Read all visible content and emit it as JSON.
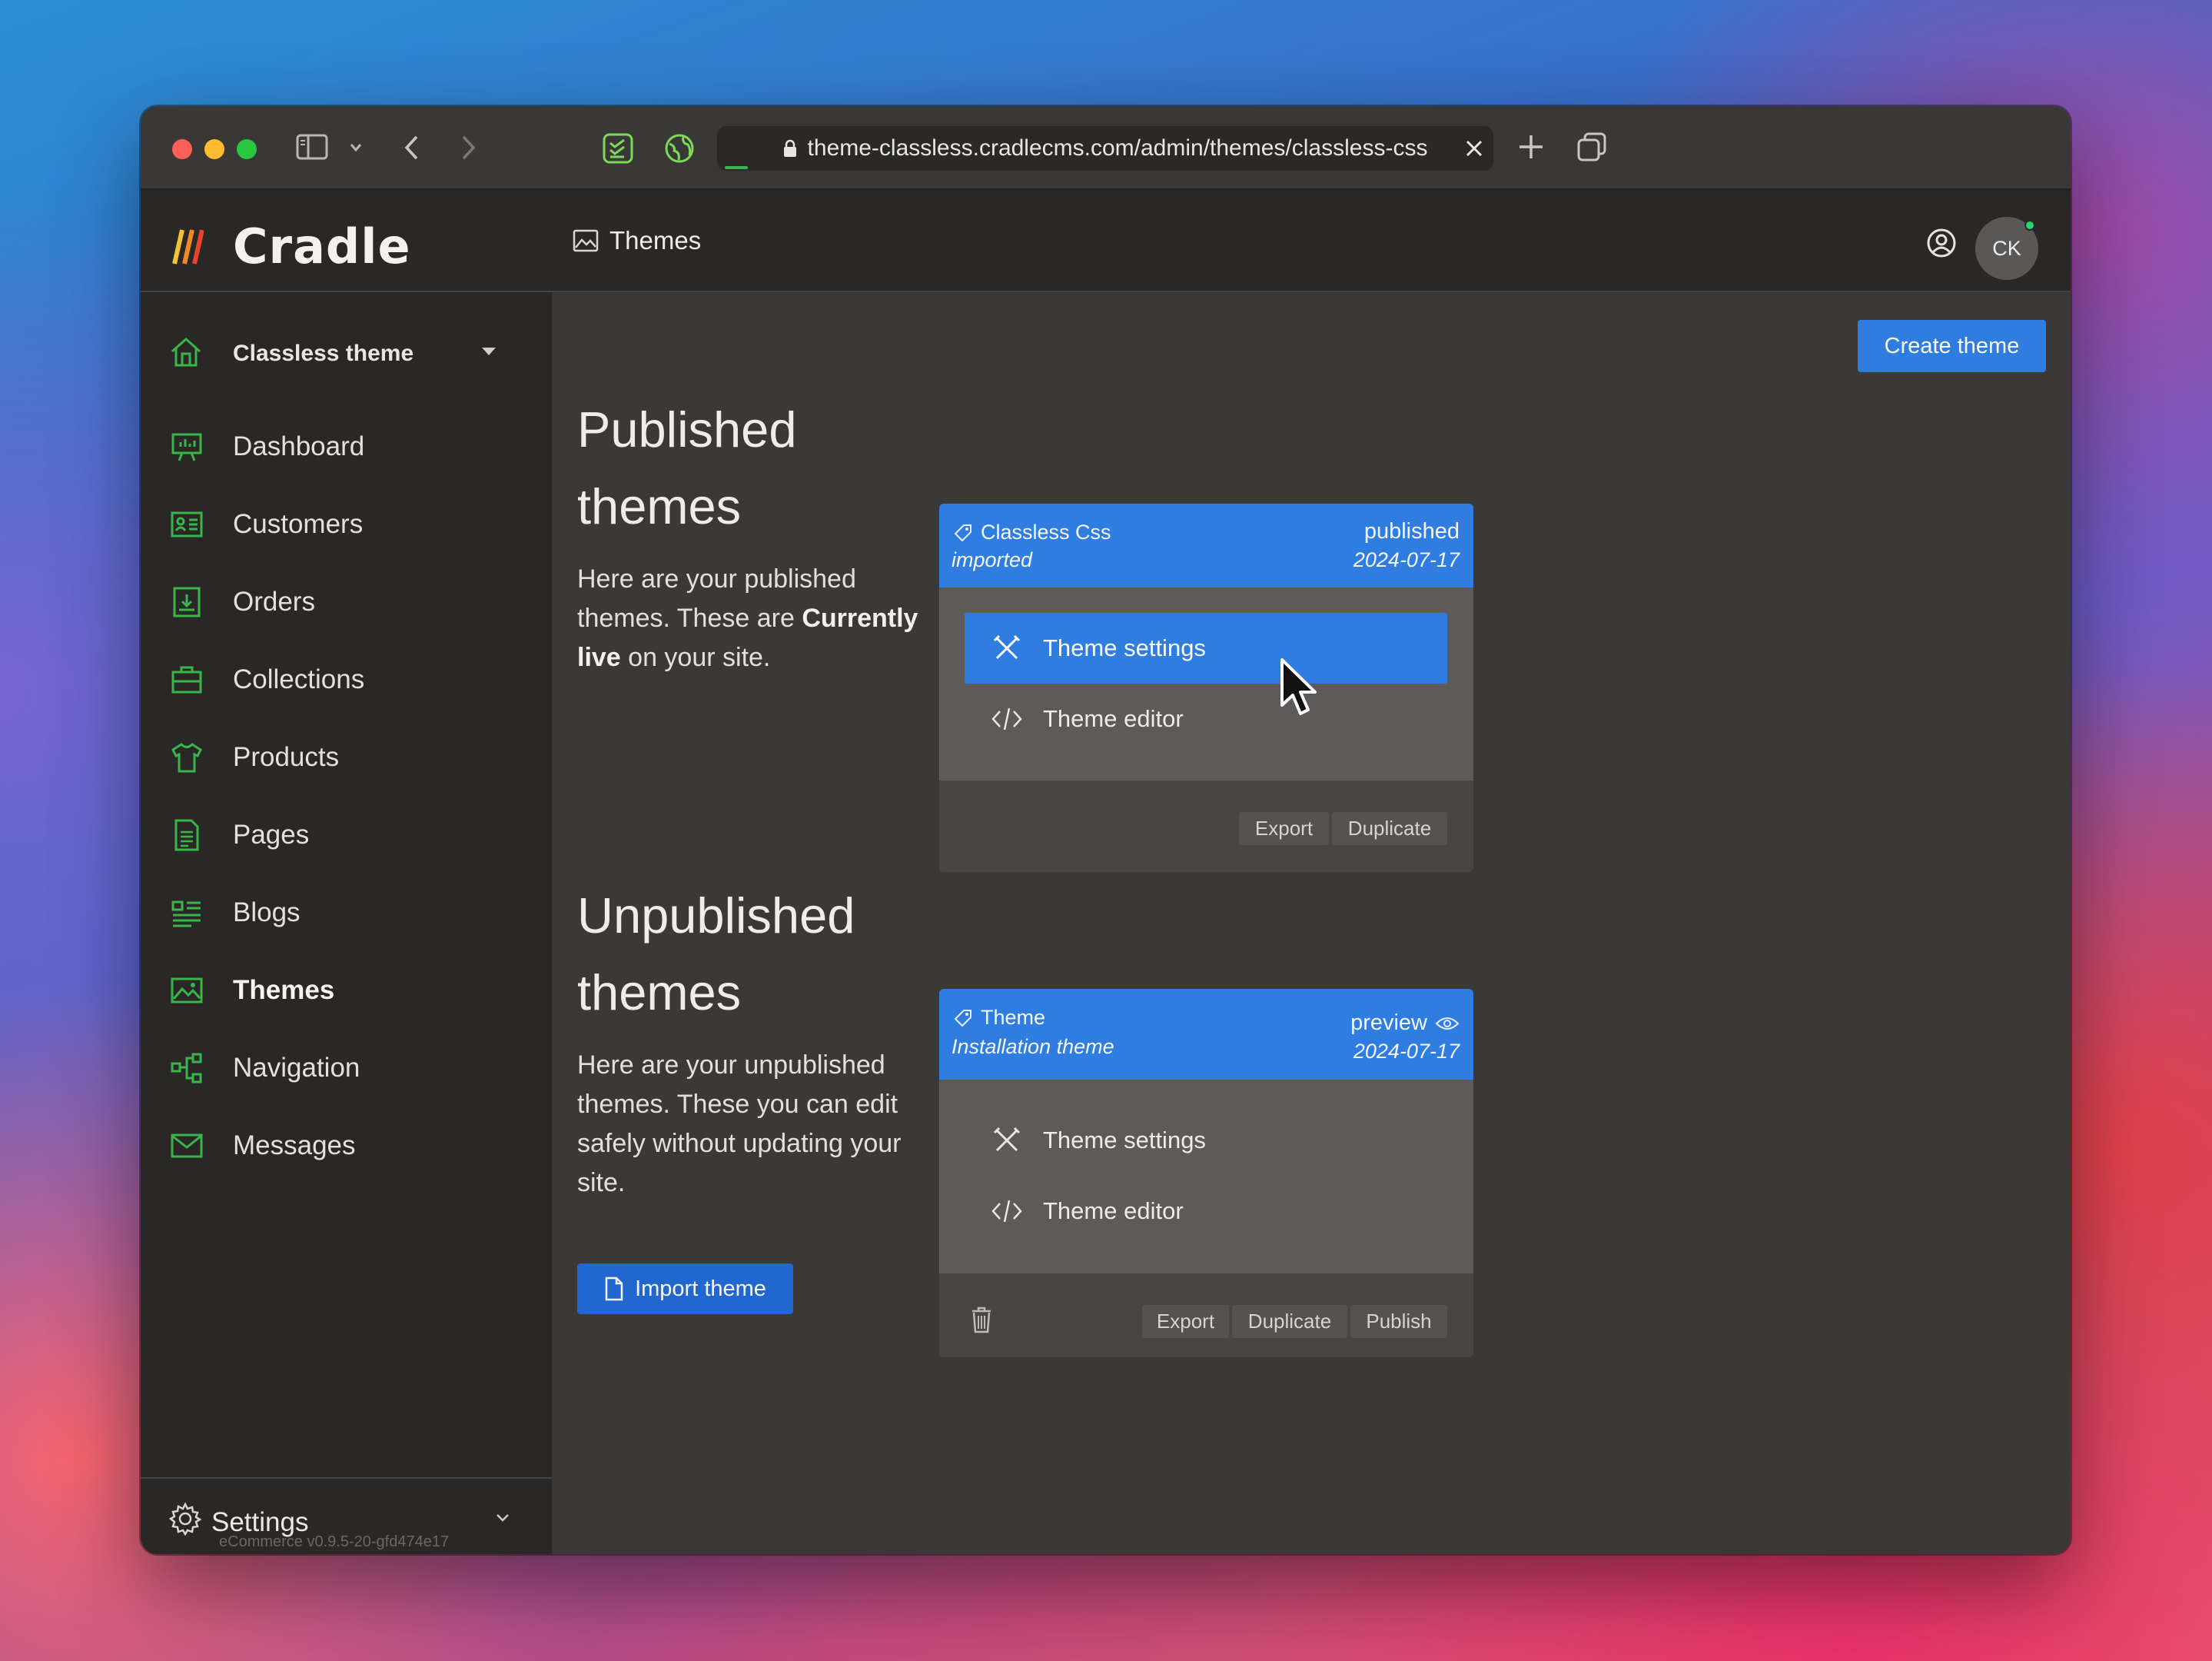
{
  "browser": {
    "url": "theme-classless.cradlecms.com/admin/themes/classless-css"
  },
  "app": {
    "logo_text": "Cradle",
    "page_title": "Themes",
    "avatar_initials": "CK",
    "accent_color": "#2f7de1",
    "icon_color": "#39b54a"
  },
  "sidebar": {
    "store_name": "Classless theme",
    "items": [
      {
        "label": "Dashboard",
        "icon": "dashboard-icon"
      },
      {
        "label": "Customers",
        "icon": "customers-icon"
      },
      {
        "label": "Orders",
        "icon": "orders-icon"
      },
      {
        "label": "Collections",
        "icon": "collections-icon"
      },
      {
        "label": "Products",
        "icon": "products-icon"
      },
      {
        "label": "Pages",
        "icon": "pages-icon"
      },
      {
        "label": "Blogs",
        "icon": "blogs-icon"
      },
      {
        "label": "Themes",
        "icon": "themes-icon",
        "active": true
      },
      {
        "label": "Navigation",
        "icon": "navigation-icon"
      },
      {
        "label": "Messages",
        "icon": "messages-icon"
      }
    ],
    "settings_label": "Settings",
    "version": "eCommerce v0.9.5-20-gfd474e17"
  },
  "main": {
    "create_button": "Create theme",
    "published": {
      "heading_line1": "Published",
      "heading_line2": "themes",
      "desc_before": "Here are your published themes. These are ",
      "desc_bold": "Currently live",
      "desc_after": " on your site.",
      "card": {
        "name": "Classless Css",
        "subtitle": "imported",
        "status": "published",
        "date": "2024-07-17",
        "menu": [
          "Theme settings",
          "Theme editor"
        ],
        "actions": [
          "Export",
          "Duplicate"
        ]
      }
    },
    "unpublished": {
      "heading_line1": "Unpublished",
      "heading_line2": "themes",
      "desc": "Here are your unpublished themes. These you can edit safely without updating your site.",
      "import_button": "Import theme",
      "card": {
        "name": "Theme",
        "subtitle": "Installation theme",
        "status": "preview",
        "date": "2024-07-17",
        "menu": [
          "Theme settings",
          "Theme editor"
        ],
        "actions": [
          "Export",
          "Duplicate",
          "Publish"
        ]
      }
    }
  }
}
